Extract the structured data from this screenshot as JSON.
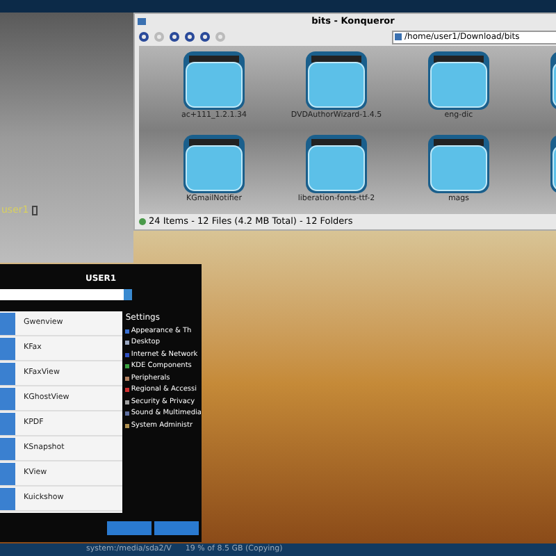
{
  "terminal": {
    "prompt": "user1"
  },
  "konqueror": {
    "title": "bits - Konqueror",
    "location": "/home/user1/Download/bits",
    "folders": [
      {
        "name": "ac+111_1.2.1.34"
      },
      {
        "name": "DVDAuthorWizard-1.4.5"
      },
      {
        "name": "eng-dic"
      },
      {
        "kind": "folder"
      },
      {
        "name": "KGmailNotifier"
      },
      {
        "name": "liberation-fonts-ttf-2"
      },
      {
        "name": "mags"
      },
      {
        "kind": "folder"
      }
    ],
    "status": "24 Items - 12 Files (4.2 MB Total) - 12 Folders"
  },
  "menu": {
    "user": "USER1",
    "apps": [
      {
        "name": "Gwenview"
      },
      {
        "name": "KFax"
      },
      {
        "name": "KFaxView"
      },
      {
        "name": "KGhostView"
      },
      {
        "name": "KPDF"
      },
      {
        "name": "KSnapshot"
      },
      {
        "name": "KView"
      },
      {
        "name": "Kuickshow"
      }
    ],
    "settings_title": "Settings",
    "settings": [
      {
        "name": "Appearance & Th",
        "color": "#3a6fd0"
      },
      {
        "name": "Desktop",
        "color": "#9aa6c0"
      },
      {
        "name": "Internet & Network",
        "color": "#3050c0"
      },
      {
        "name": "KDE Components",
        "color": "#3aa040"
      },
      {
        "name": "Peripherals",
        "color": "#b08060"
      },
      {
        "name": "Regional & Accessi",
        "color": "#d03030"
      },
      {
        "name": "Security & Privacy",
        "color": "#a0a0a0"
      },
      {
        "name": "Sound & Multimedia",
        "color": "#6070a0"
      },
      {
        "name": "System Administr",
        "color": "#b09050"
      }
    ]
  },
  "taskbar": [
    {
      "label": "system:/media/sda2/V"
    },
    {
      "label": "19 % of 8.5 GB (Copying)"
    }
  ]
}
